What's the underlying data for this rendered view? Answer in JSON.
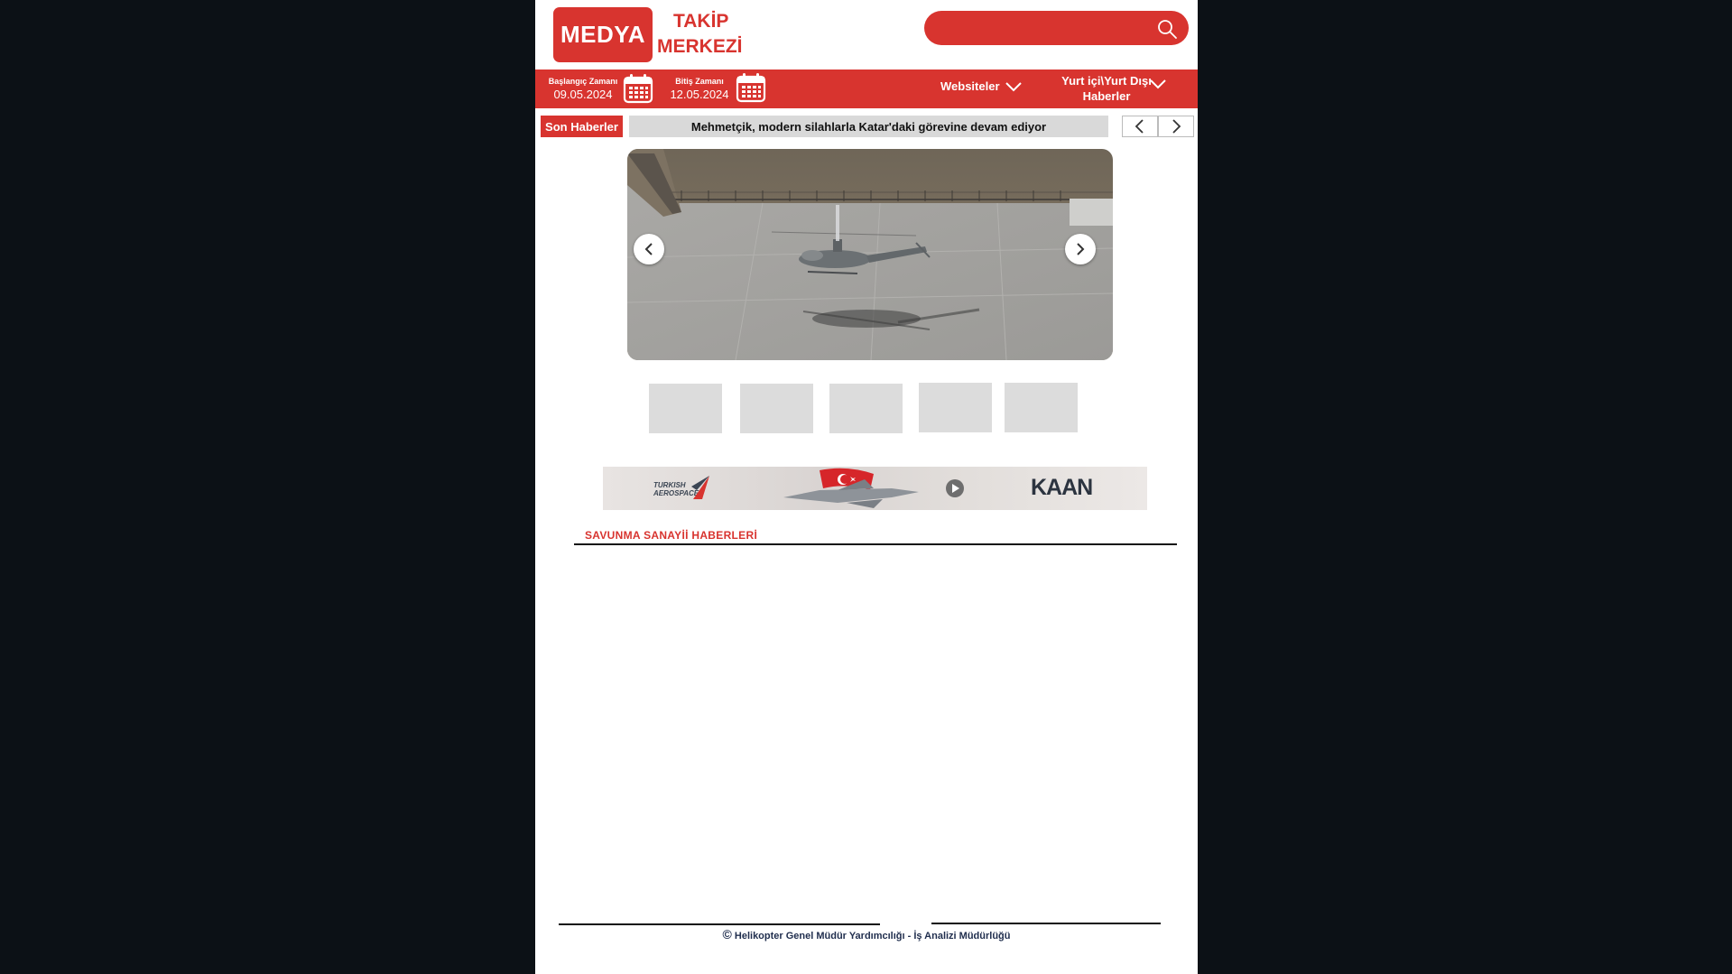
{
  "logo": {
    "box_text": "MEDYA",
    "line1": "TAKİP",
    "line2": "MERKEZİ"
  },
  "search": {
    "placeholder": ""
  },
  "toolbar": {
    "start_label": "Başlangıç Zamanı",
    "start_value": "09.05.2024",
    "end_label": "Bitiş Zamanı",
    "end_value": "12.05.2024",
    "menu_websites": "Websiteler",
    "menu_news_line1": "Yurt içi\\Yurt Dışı",
    "menu_news_line2": "Haberler"
  },
  "ticker": {
    "label": "Son Haberler",
    "headline": "Mehmetçik, modern silahlarla Katar'daki görevine devam ediyor"
  },
  "banner": {
    "brand_line1": "TURKISH",
    "brand_line2": "AEROSPACE",
    "product": "KAAN"
  },
  "section": {
    "title": "SAVUNMA SANAYİİ HABERLERİ"
  },
  "footer": {
    "copyright_symbol": "©",
    "text": "Helikopter Genel Müdür Yardımcılığı - İş Analizi Müdürlüğü"
  },
  "colors": {
    "brand_red": "#d8342f",
    "outer_bg": "#0c1116"
  }
}
